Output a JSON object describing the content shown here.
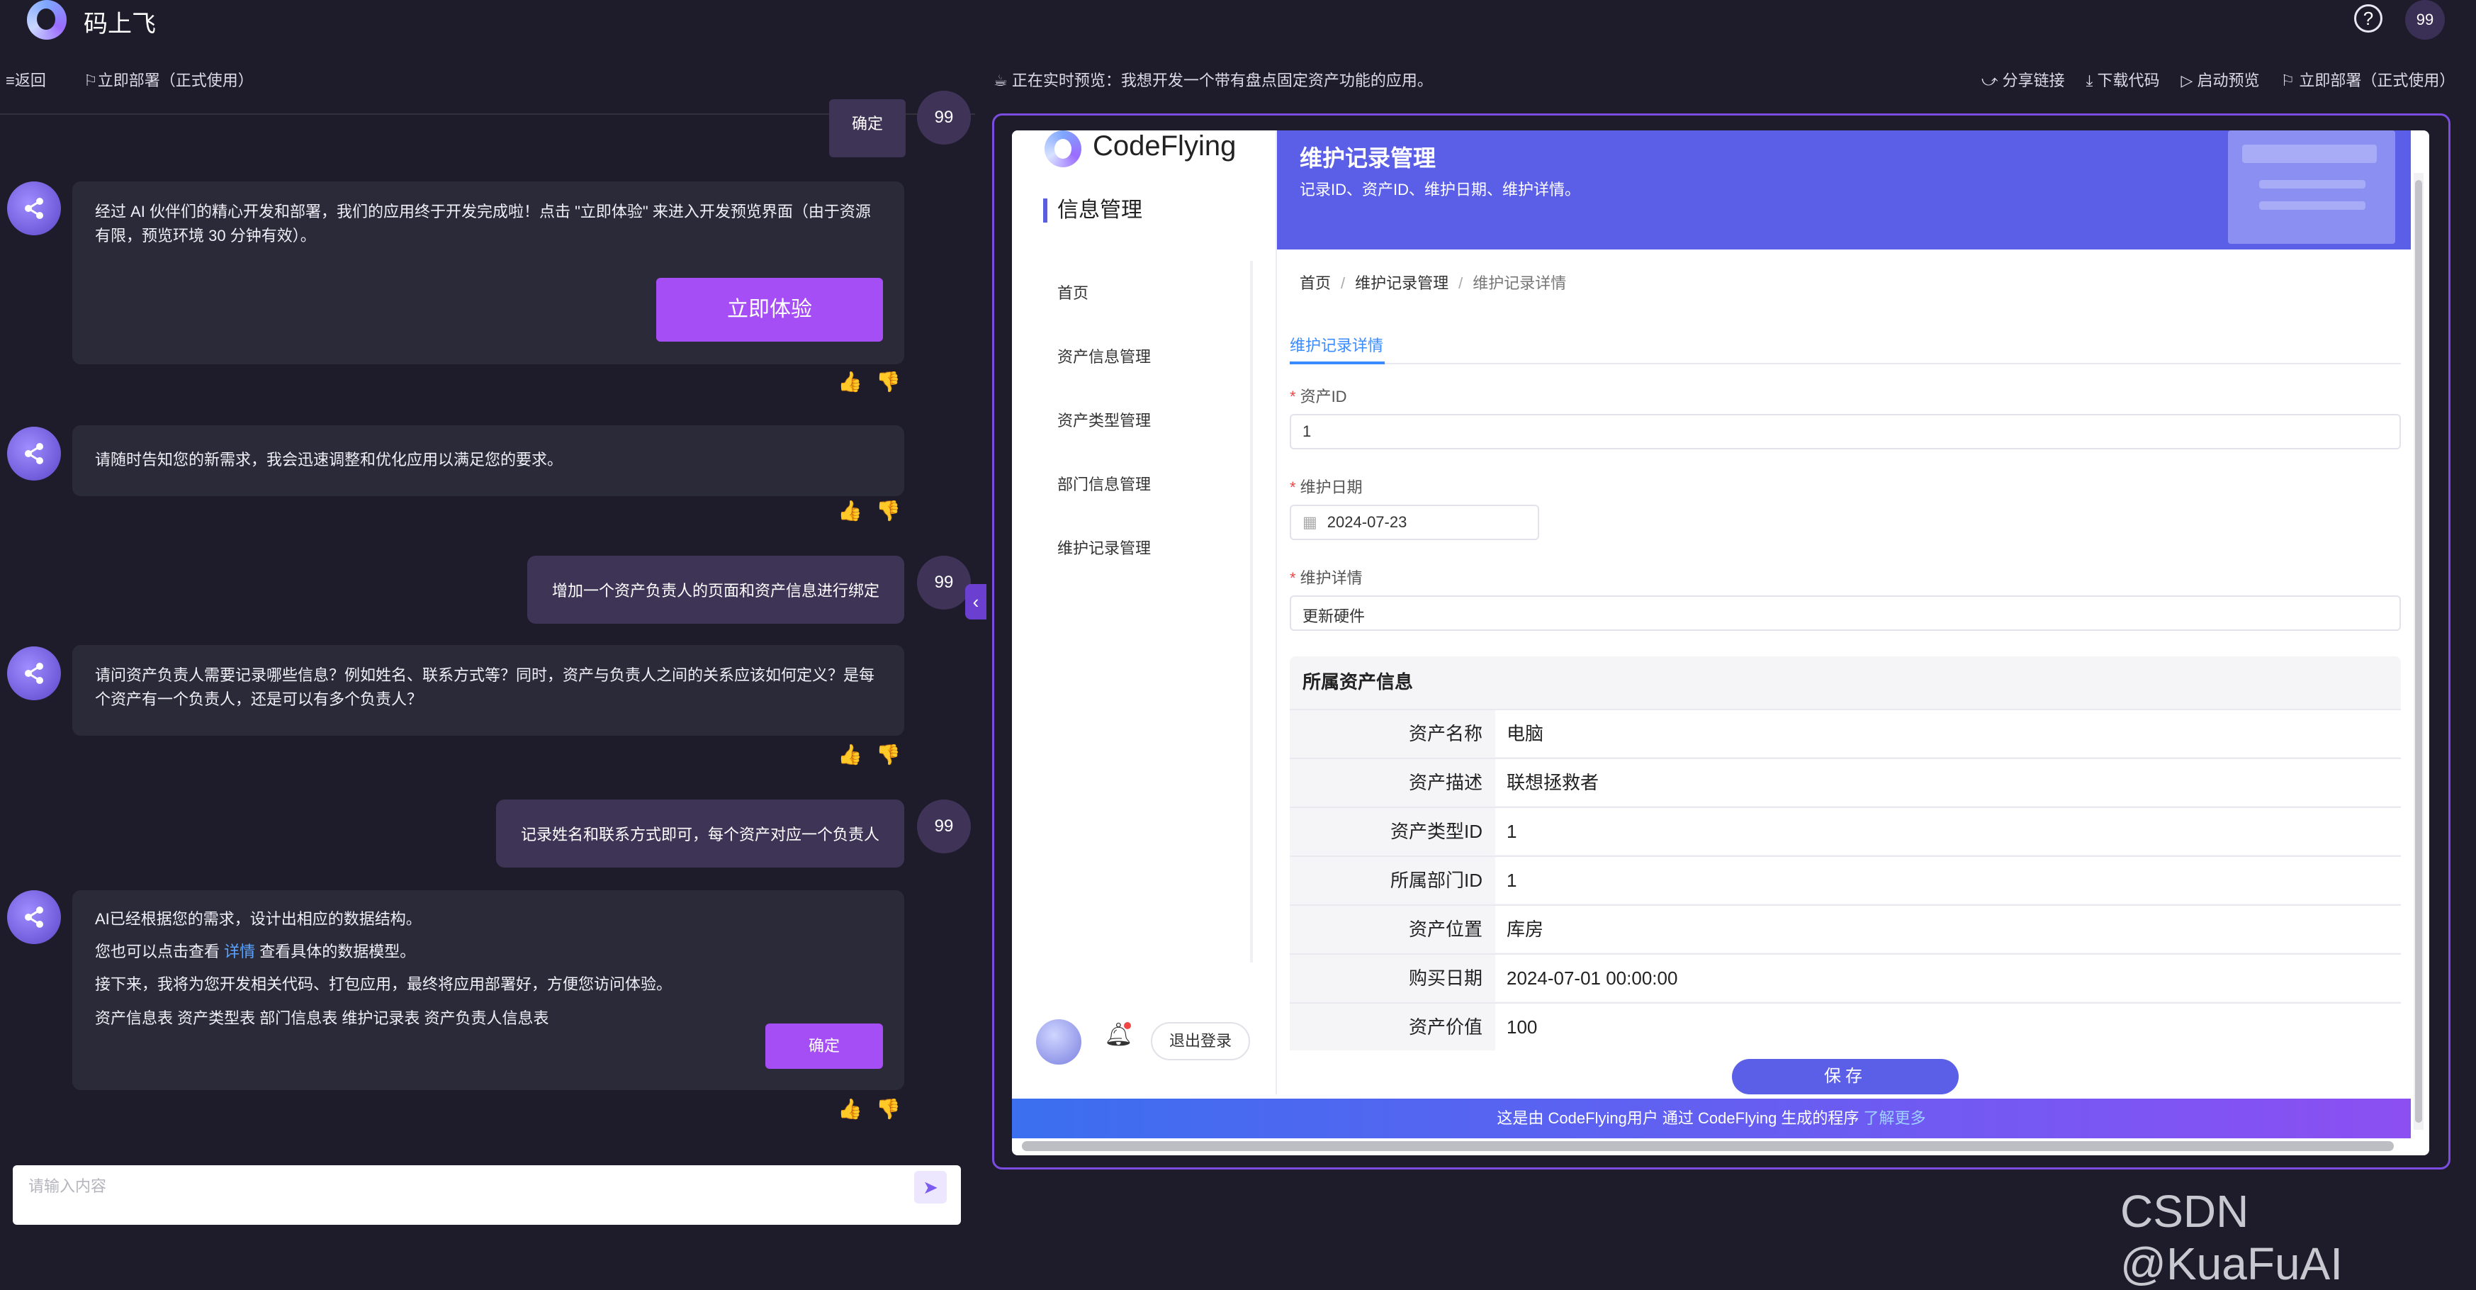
{
  "app": {
    "title": "码上飞",
    "avatar_text": "99"
  },
  "subbar": {
    "back": "≡返回",
    "deploy_left": "⚐立即部署（正式使用）",
    "preview_status": "☕ 正在实时预览：我想开发一个带有盘点固定资产功能的应用。",
    "actions": [
      "⤻ 分享链接",
      "⤓ 下载代码",
      "▷ 启动预览",
      "⚐ 立即部署（正式使用）"
    ]
  },
  "chat": {
    "prev_confirm": "确定",
    "msg1": {
      "text": "经过 AI 伙伴们的精心开发和部署，我们的应用终于开发完成啦！点击 \"立即体验\" 来进入开发预览界面（由于资源有限，预览环境 30 分钟有效）。",
      "button": "立即体验"
    },
    "msg2": "请随时告知您的新需求，我会迅速调整和优化应用以满足您的要求。",
    "user1": "增加一个资产负责人的页面和资产信息进行绑定",
    "msg3": "请问资产负责人需要记录哪些信息？例如姓名、联系方式等？同时，资产与负责人之间的关系应该如何定义？是每个资产有一个负责人，还是可以有多个负责人？",
    "user2": "记录姓名和联系方式即可，每个资产对应一个负责人",
    "msg4": {
      "line1": "AI已经根据您的需求，设计出相应的数据结构。",
      "line2_pre": "您也可以点击查看 ",
      "line2_link": "详情",
      "line2_post": " 查看具体的数据模型。",
      "line3": "接下来，我将为您开发相关代码、打包应用，最终将应用部署好，方便您访问体验。",
      "tables": "资产信息表 资产类型表 部门信息表 维护记录表 资产负责人信息表",
      "button": "确定"
    },
    "user_avatar": "99",
    "input_placeholder": "请输入内容"
  },
  "preview": {
    "brand": "CodeFlying",
    "sidebar_title": "信息管理",
    "menu": [
      "首页",
      "资产信息管理",
      "资产类型管理",
      "部门信息管理",
      "维护记录管理"
    ],
    "logout": "退出登录",
    "banner_title": "维护记录管理",
    "banner_sub": "记录ID、资产ID、维护日期、维护详情。",
    "breadcrumb": [
      "首页",
      "维护记录管理",
      "维护记录详情"
    ],
    "tab": "维护记录详情",
    "fields": {
      "asset_id_label": "资产ID",
      "asset_id_value": "1",
      "date_label": "维护日期",
      "date_value": "2024-07-23",
      "detail_label": "维护详情",
      "detail_value": "更新硬件"
    },
    "asset_section_title": "所属资产信息",
    "asset_rows": [
      {
        "key": "资产名称",
        "value": "电脑"
      },
      {
        "key": "资产描述",
        "value": "联想拯救者"
      },
      {
        "key": "资产类型ID",
        "value": "1"
      },
      {
        "key": "所属部门ID",
        "value": "1"
      },
      {
        "key": "资产位置",
        "value": "库房"
      },
      {
        "key": "购买日期",
        "value": "2024-07-01 00:00:00"
      },
      {
        "key": "资产价值",
        "value": "100"
      }
    ],
    "save": "保存",
    "footer_text": "这是由 CodeFlying用户 通过 CodeFlying 生成的程序 ",
    "footer_link": "了解更多"
  },
  "watermark": "CSDN @KuaFuAI",
  "colors": {
    "accent_purple": "#a54ef5",
    "banner_blue": "#5b5fe8",
    "link_blue": "#3a8bff"
  }
}
